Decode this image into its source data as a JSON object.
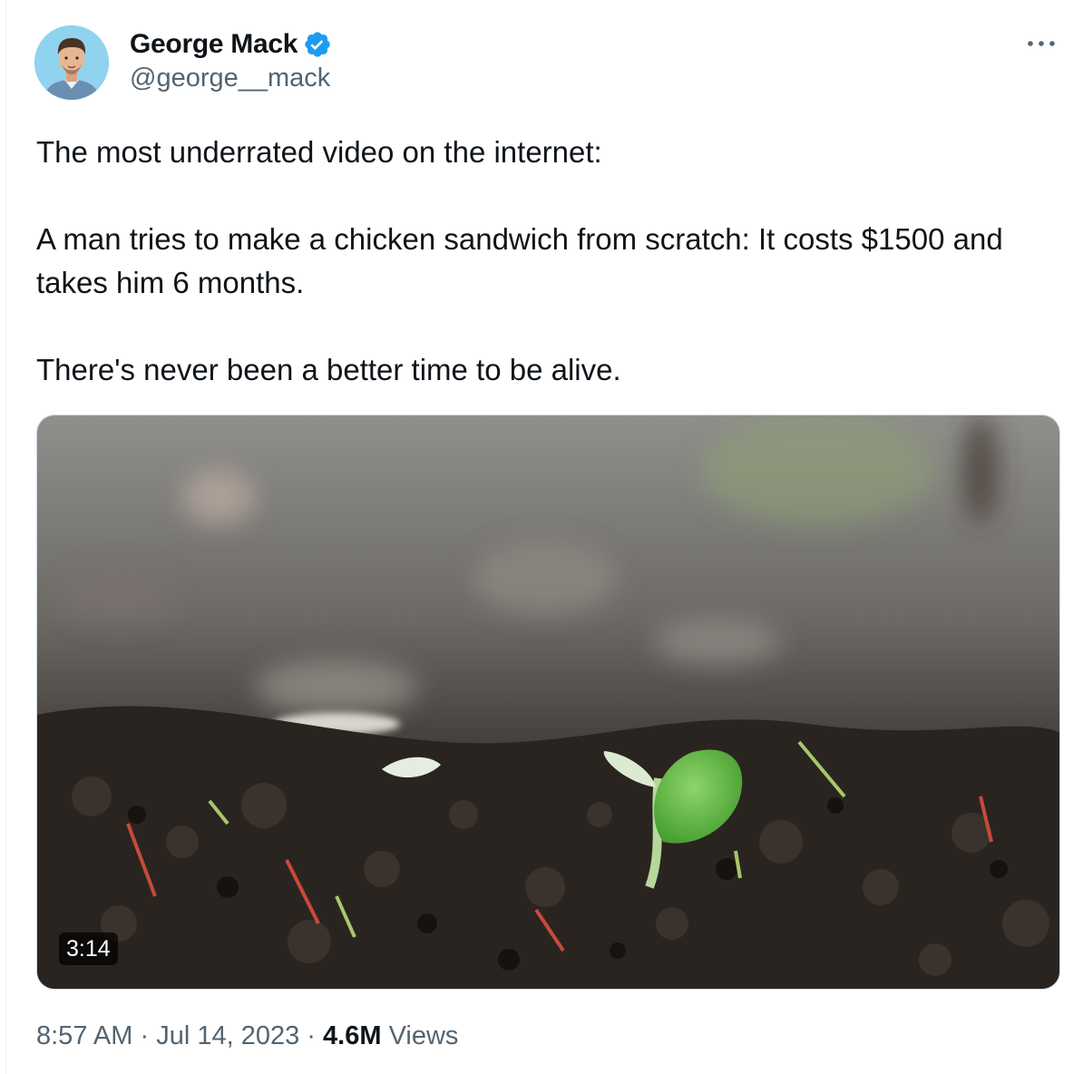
{
  "author": {
    "display_name": "George Mack",
    "handle": "@george__mack",
    "verified": true,
    "avatar_icon": "cartoon-portrait-avatar"
  },
  "tweet": {
    "paragraphs": [
      "The most underrated video on the internet:",
      "A man tries to make a chicken sandwich from scratch: It costs $1500 and takes him 6 months.",
      "There's never been a better time to be alive."
    ]
  },
  "media": {
    "type": "video",
    "duration": "3:14",
    "scene_icon": "seedling-in-soil-thumbnail"
  },
  "meta": {
    "time": "8:57 AM",
    "separator": "·",
    "date": "Jul 14, 2023",
    "views_count": "4.6M",
    "views_label": "Views"
  },
  "icons": {
    "verified": "verified-badge-icon",
    "more": "more-options-icon"
  },
  "colors": {
    "text_primary": "#0f1419",
    "text_secondary": "#536471",
    "verified_blue": "#1d9bf0",
    "border": "#cfd9de"
  }
}
